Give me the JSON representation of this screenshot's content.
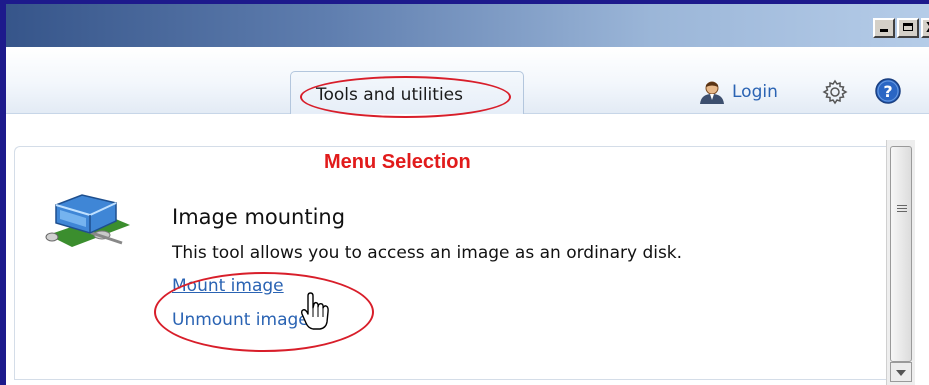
{
  "window": {
    "controls": [
      "minimize",
      "maximize",
      "close"
    ],
    "close_glyph": "X"
  },
  "tabs": [
    {
      "label": "Tools and utilities",
      "active": true
    }
  ],
  "header": {
    "login_label": "Login",
    "icons": [
      "user-icon",
      "gear-icon",
      "help-icon"
    ]
  },
  "annotations": {
    "menu_selection": "Menu Selection",
    "highlight_color": "#d81e2a"
  },
  "tool": {
    "title": "Image mounting",
    "description": "This tool allows you to access an image as an ordinary disk.",
    "links": [
      {
        "label": "Mount image"
      },
      {
        "label": "Unmount image"
      }
    ],
    "icon": "disk-mount-icon"
  },
  "colors": {
    "link": "#2a63b3",
    "window_border": "#1d1a8c"
  }
}
